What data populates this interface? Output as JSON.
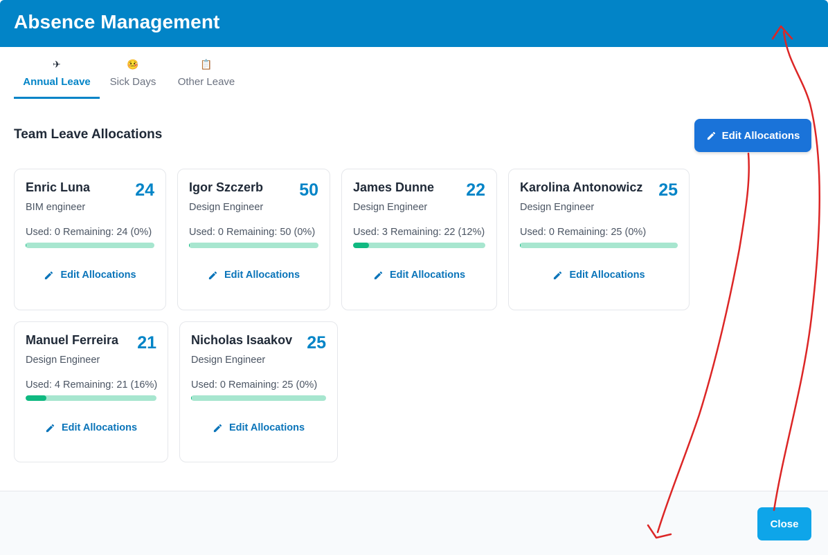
{
  "header": {
    "title": "Absence Management"
  },
  "tabs": [
    {
      "label": "Annual Leave",
      "icon": "airplane-icon",
      "glyph": "✈"
    },
    {
      "label": "Sick Days",
      "icon": "sick-face-icon",
      "glyph": "🤒"
    },
    {
      "label": "Other Leave",
      "icon": "clipboard-icon",
      "glyph": "📋"
    }
  ],
  "section": {
    "title": "Team Leave Allocations",
    "edit_label": "Edit Allocations"
  },
  "cards": [
    {
      "name": "Enric Luna",
      "total": "24",
      "role": "BIM engineer",
      "usage": "Used: 0 Remaining: 24 (0%)",
      "used_fraction": 0.0,
      "edit_label": "Edit Allocations"
    },
    {
      "name": "Igor Szczerb",
      "total": "50",
      "role": "Design Engineer",
      "usage": "Used: 0 Remaining: 50 (0%)",
      "used_fraction": 0.0,
      "edit_label": "Edit Allocations"
    },
    {
      "name": "James Dunne",
      "total": "22",
      "role": "Design Engineer",
      "usage": "Used: 3 Remaining: 22 (12%)",
      "used_fraction": 0.12,
      "edit_label": "Edit Allocations"
    },
    {
      "name": "Karolina Antonowicz",
      "total": "25",
      "role": "Design Engineer",
      "usage": "Used: 0 Remaining: 25 (0%)",
      "used_fraction": 0.0,
      "edit_label": "Edit Allocations"
    },
    {
      "name": "Manuel Ferreira",
      "total": "21",
      "role": "Design Engineer",
      "usage": "Used: 4 Remaining: 21 (16%)",
      "used_fraction": 0.16,
      "edit_label": "Edit Allocations"
    },
    {
      "name": "Nicholas Isaakov",
      "total": "25",
      "role": "Design Engineer",
      "usage": "Used: 0 Remaining: 25 (0%)",
      "used_fraction": 0.0,
      "edit_label": "Edit Allocations"
    }
  ],
  "footer": {
    "close_label": "Close"
  },
  "colors": {
    "primary": "#0284c7",
    "button": "#1a73d9",
    "close": "#0ea5e9",
    "bar_fill": "#10b981",
    "bar_track": "#a7e6cf",
    "annotation": "#dc2626"
  }
}
